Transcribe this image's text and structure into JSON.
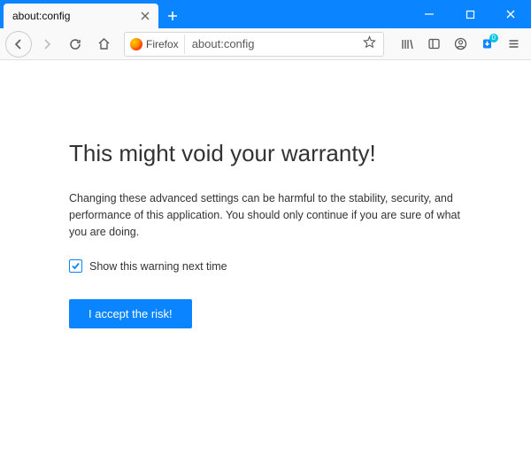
{
  "window": {
    "tab_title": "about:config",
    "newtab_tooltip": "New Tab"
  },
  "toolbar": {
    "identity_label": "Firefox",
    "url": "about:config"
  },
  "content": {
    "heading": "This might void your warranty!",
    "warning_text": "Changing these advanced settings can be harmful to the stability, security, and performance of this application. You should only continue if you are sure of what you are doing.",
    "checkbox_label": "Show this warning next time",
    "checkbox_checked": true,
    "accept_button": "I accept the risk!"
  },
  "colors": {
    "accent": "#0a84ff"
  }
}
